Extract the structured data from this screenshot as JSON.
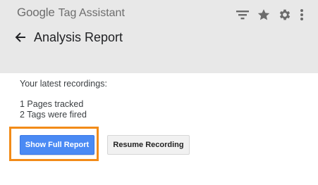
{
  "header": {
    "brand_google": "Google",
    "brand_app": "Tag Assistant",
    "page_title": "Analysis Report",
    "icons": [
      "filter-icon",
      "star-icon",
      "gear-icon",
      "more-vert-icon"
    ],
    "back_icon": "arrow-back-icon"
  },
  "main": {
    "latest_label": "Your latest recordings:",
    "pages_tracked": "1 Pages tracked",
    "tags_fired": "2 Tags were fired"
  },
  "actions": {
    "show_full_report": "Show Full Report",
    "resume_recording": "Resume Recording"
  },
  "colors": {
    "header_bg": "#e8e8e8",
    "primary_button": "#4a8af4",
    "highlight_border": "#f28b18",
    "icon_gray": "#6b6b6b"
  }
}
